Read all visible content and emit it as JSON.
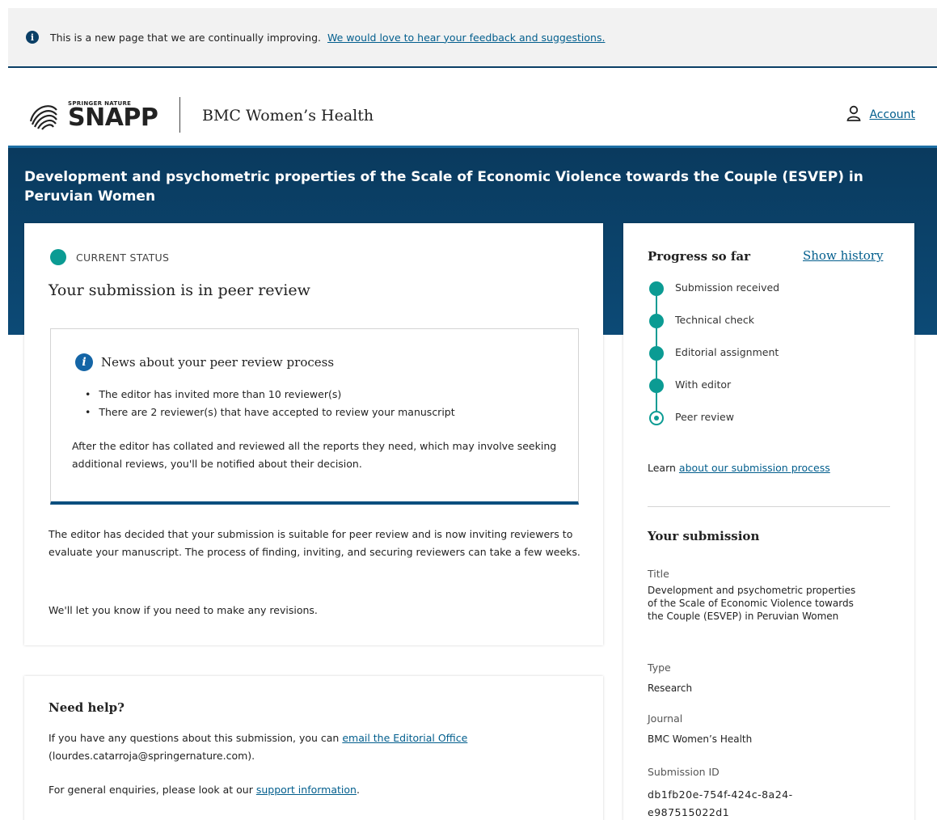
{
  "banner": {
    "text": "This is a new page that we are continually improving.",
    "link": "We would love to hear your feedback and suggestions."
  },
  "header": {
    "logo_top": "SPRINGER NATURE",
    "logo_main": "SNAPP",
    "journal": "BMC Women’s Health",
    "account_label": "Account"
  },
  "hero": {
    "title": "Development and psychometric properties of the Scale of Economic Violence towards the Couple (ESVEP) in Peruvian Women"
  },
  "status": {
    "label": "CURRENT STATUS",
    "title": "Your submission is in peer review",
    "news_title": "News about your peer review process",
    "news_items": [
      "The editor has invited more than 10 reviewer(s)",
      "There are 2 reviewer(s) that have accepted to review your manuscript"
    ],
    "news_text": "After the editor has collated and reviewed all the reports they need, which may involve seeking additional reviews, you'll be notified about their decision.",
    "body_1": "The editor has decided that your submission is suitable for peer review and is now inviting reviewers to evaluate your manuscript. The process of finding, inviting, and securing reviewers can take a few weeks.",
    "body_2": "We'll let you know if you need to make any revisions."
  },
  "help": {
    "title": "Need help?",
    "line1_pre": "If you have any questions about this submission, you can",
    "line1_link": "email the Editorial Office",
    "line1_post": "(lourdes.catarroja@springernature.com).",
    "line2_pre": "For general enquiries, please look at our",
    "line2_link": "support information",
    "line2_post": "."
  },
  "progress": {
    "title": "Progress so far",
    "show_history": "Show history",
    "steps": [
      {
        "label": "Submission received",
        "state": "done"
      },
      {
        "label": "Technical check",
        "state": "done"
      },
      {
        "label": "Editorial assignment",
        "state": "done"
      },
      {
        "label": "With editor",
        "state": "done"
      },
      {
        "label": "Peer review",
        "state": "current"
      }
    ],
    "learn_pre": "Learn",
    "learn_link": "about our submission process"
  },
  "submission": {
    "title": "Your submission",
    "title_label": "Title",
    "title_value": "Development and psychometric properties of the Scale of Economic Violence towards the Couple (ESVEP) in Peruvian Women",
    "type_label": "Type",
    "type_value": "Research",
    "journal_label": "Journal",
    "journal_value": "BMC Women’s Health",
    "id_label": "Submission ID",
    "id_value": "db1fb20e-754f-424c-8a24-e987515022d1"
  },
  "colors": {
    "navy": "#0b3f66",
    "teal": "#0b9b93",
    "link": "#025e8d"
  }
}
